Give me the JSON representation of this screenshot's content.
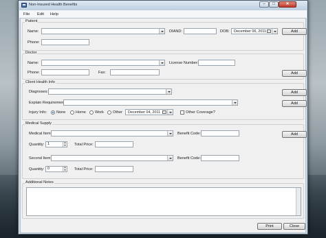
{
  "window": {
    "title": "Non-Insured Health Benefits",
    "minimize": "–",
    "maximize": "□",
    "close": "✕"
  },
  "menu": [
    "File",
    "Edit",
    "Help"
  ],
  "patient": {
    "group_label": "Patient",
    "name_label": "Name:",
    "diand_label": "DIAND:",
    "dob_label": "DOB:",
    "dob_value": "December 06, 2011",
    "add_label": "Add",
    "phone_label": "Phone:"
  },
  "doctor": {
    "group_label": "Doctor",
    "name_label": "Name:",
    "license_label": "License Number:",
    "phone_label": "Phone:",
    "fax_label": "Fax:",
    "add_label": "Add"
  },
  "client_health": {
    "group_label": "Client Health Info",
    "diagnoses_label": "Diagnoses:",
    "diagnoses_add": "Add",
    "explain_label": "Explain Requirement:",
    "explain_add": "Add",
    "injury_label": "Injury Info:",
    "injury_options": [
      "None",
      "Home",
      "Work",
      "Other"
    ],
    "injury_selected": "None",
    "injury_date": "December 04, 2011",
    "other_coverage_label": "Other Coverage?"
  },
  "medical_supply": {
    "group_label": "Medical Supply",
    "medical_item_label": "Medical Item:",
    "benefit_code_label": "Benefit Code:",
    "add_label": "Add",
    "quantity_label": "Quantity:",
    "quantity1_value": "1",
    "total_price_label": "Total Price:",
    "second_item_label": "Second Item:",
    "benefit_code2_label": "Benefit Code:",
    "quantity2_value": "0",
    "total_price2_label": "Total Price:"
  },
  "notes": {
    "group_label": "Additional Notes"
  },
  "footer": {
    "print_label": "Print",
    "close_label": "Close"
  }
}
